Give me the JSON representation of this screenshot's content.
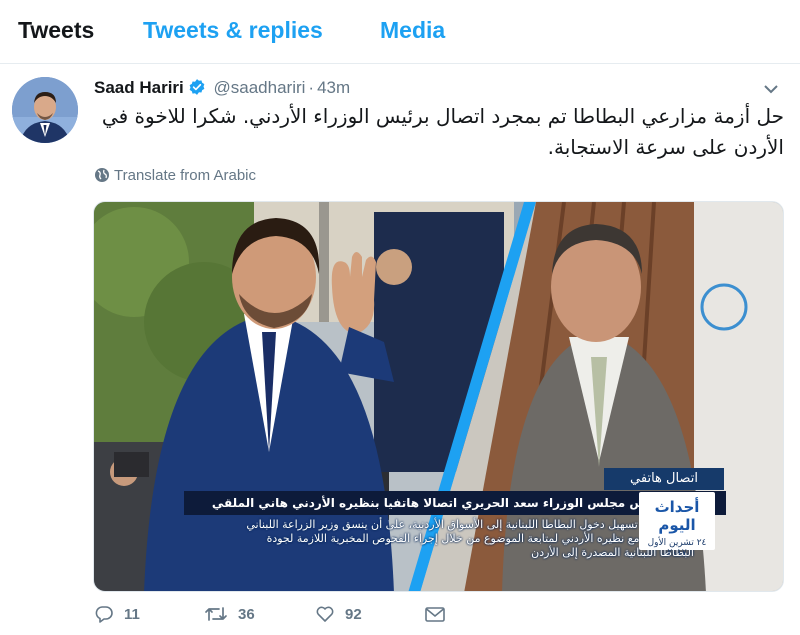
{
  "tabs": [
    {
      "label": "Tweets",
      "active": true
    },
    {
      "label": "Tweets & replies",
      "active": false
    },
    {
      "label": "Media",
      "active": false
    }
  ],
  "tweet": {
    "author_name": "Saad Hariri",
    "verified": true,
    "handle": "@saadhariri",
    "separator": "·",
    "time": "43m",
    "text": "حل أزمة مزارعي البطاطا تم بمجرد اتصال برئيس الوزراء الأردني. شكرا للاخوة في الأردن على سرعة الاستجابة.",
    "translate_label": "Translate from Arabic",
    "media": {
      "caption_label": "اتصال هاتفي",
      "caption_headline": "أجرى رئيس مجلس الوزراء سعد الحريري اتصالا هاتفيا بنظيره الأردني هاني الملقي",
      "caption_body": "الاتفاق على تسهيل دخول البطاطا اللبنانية إلى الأسواق الأردنية، على أن ينسق وزير الزراعة اللبناني غازي زعيتر مع نظيره الأردني لمتابعة الموضوع من خلال إجراء الفحوص المخبرية اللازمة لجودة البطاطا اللبنانية المصدرة إلى الأردن",
      "logo_title": "أحداث اليوم",
      "logo_date": "٢٤ تشرين الأول ٢٠١٧"
    },
    "actions": {
      "reply_count": "11",
      "retweet_count": "36",
      "like_count": "92"
    }
  },
  "colors": {
    "accent": "#1da1f2",
    "text_primary": "#14171a",
    "text_secondary": "#657786",
    "border": "#e6ecf0"
  },
  "icons": [
    "verified-badge-icon",
    "chevron-down-icon",
    "globe-icon",
    "reply-icon",
    "retweet-icon",
    "heart-icon",
    "mail-icon"
  ]
}
